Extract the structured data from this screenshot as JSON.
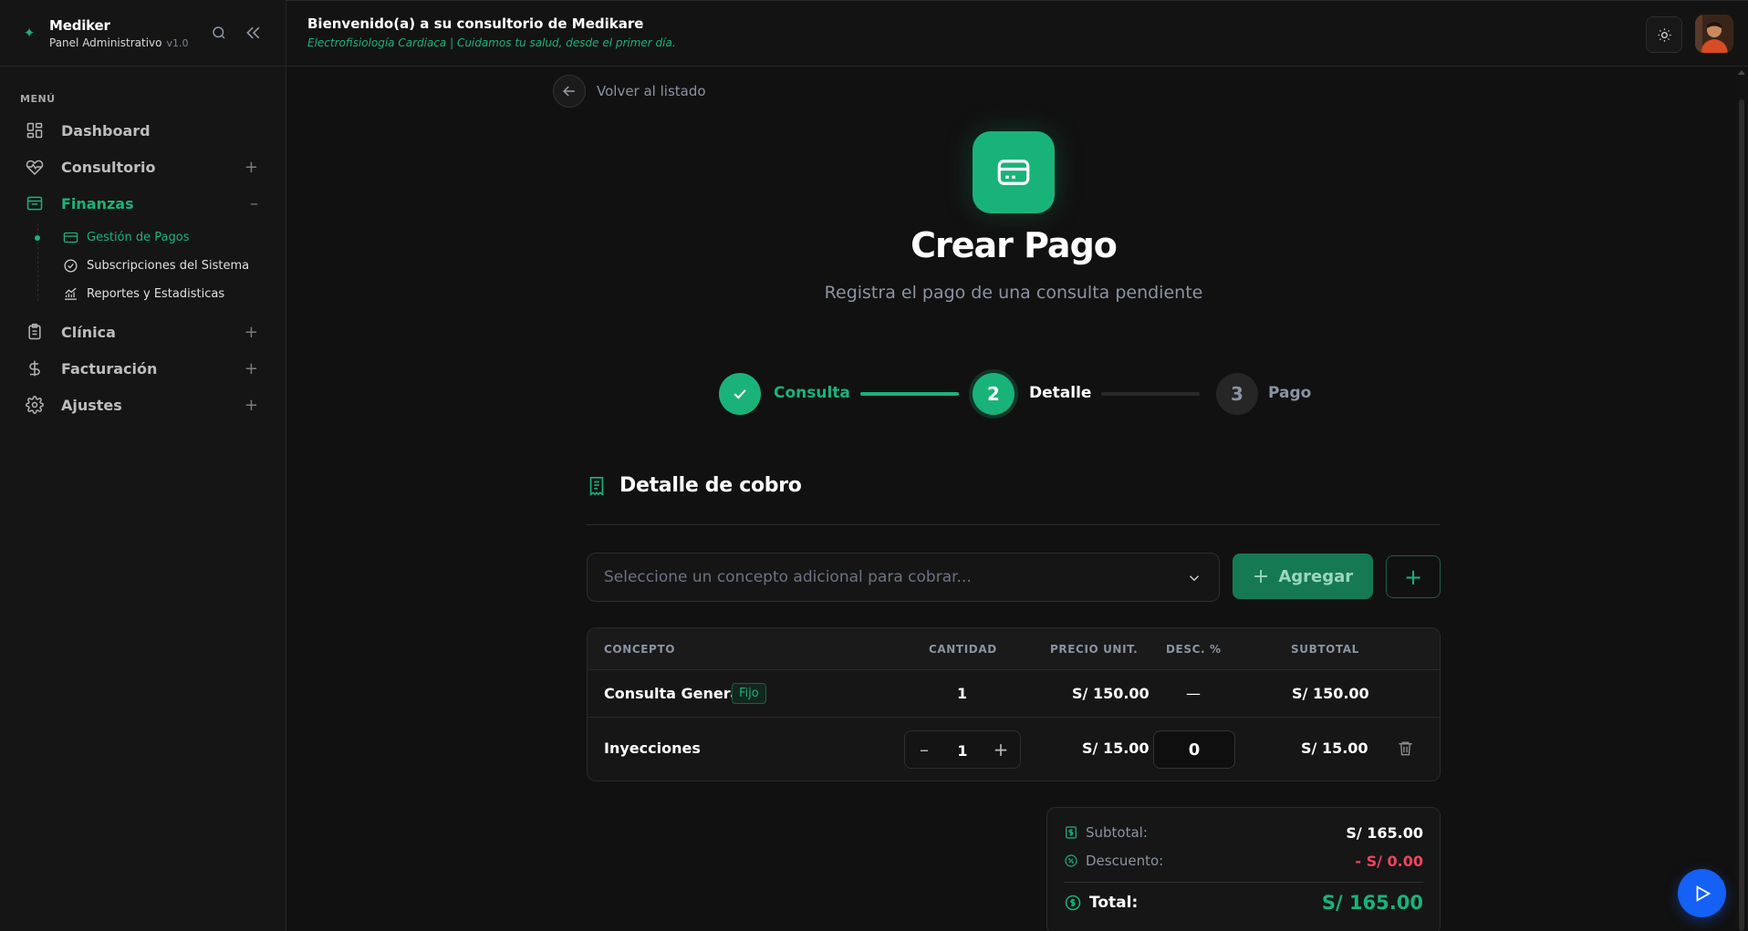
{
  "brand": {
    "name": "Mediker",
    "subtitle": "Panel Administrativo",
    "version": "v1.0"
  },
  "sidebar": {
    "menu_label": "MENÚ",
    "items": [
      {
        "label": "Dashboard"
      },
      {
        "label": "Consultorio",
        "toggle": "+"
      },
      {
        "label": "Finanzas",
        "toggle": "–"
      },
      {
        "label": "Clínica",
        "toggle": "+"
      },
      {
        "label": "Facturación",
        "toggle": "+"
      },
      {
        "label": "Ajustes",
        "toggle": "+"
      }
    ],
    "finanzas_sub": [
      {
        "label": "Gestión de Pagos"
      },
      {
        "label": "Subscripciones del Sistema"
      },
      {
        "label": "Reportes y Estadisticas"
      }
    ]
  },
  "header": {
    "welcome": "Bienvenido(a) a su consultorio de Medikare",
    "tagline": "Electrofisiología Cardiaca | Cuidamos tu salud, desde el primer día."
  },
  "page": {
    "back_label": "Volver al listado",
    "title": "Crear Pago",
    "subtitle": "Registra el pago de una consulta pendiente"
  },
  "stepper": {
    "steps": [
      {
        "label": "Consulta",
        "number": "",
        "state": "done"
      },
      {
        "label": "Detalle",
        "number": "2",
        "state": "current"
      },
      {
        "label": "Pago",
        "number": "3",
        "state": "pending"
      }
    ]
  },
  "detail": {
    "section_title": "Detalle de cobro",
    "select_placeholder": "Seleccione un concepto adicional para cobrar...",
    "add_label": "Agregar",
    "columns": [
      "CONCEPTO",
      "CANTIDAD",
      "PRECIO UNIT.",
      "DESC. %",
      "SUBTOTAL"
    ],
    "rows": [
      {
        "concept": "Consulta General",
        "badge": "Fijo",
        "qty": "1",
        "unit_price": "S/ 150.00",
        "discount": "—",
        "subtotal": "S/ 150.00"
      },
      {
        "concept": "Inyecciones",
        "qty": "1",
        "unit_price": "S/ 15.00",
        "discount": "0",
        "subtotal": "S/ 15.00"
      }
    ]
  },
  "summary": {
    "subtotal_label": "Subtotal:",
    "subtotal_value": "S/ 165.00",
    "discount_label": "Descuento:",
    "discount_value": "- S/ 0.00",
    "total_label": "Total:",
    "total_value": "S/ 165.00"
  },
  "colors": {
    "accent": "#19b37a",
    "danger": "#f0445e",
    "fab": "#1560f5",
    "background": "#111111"
  },
  "icons": {
    "brand": "leaf-icon",
    "search": "search-icon",
    "collapse": "double-chevron-left-icon",
    "theme": "sun-icon",
    "fab": "play-icon"
  }
}
